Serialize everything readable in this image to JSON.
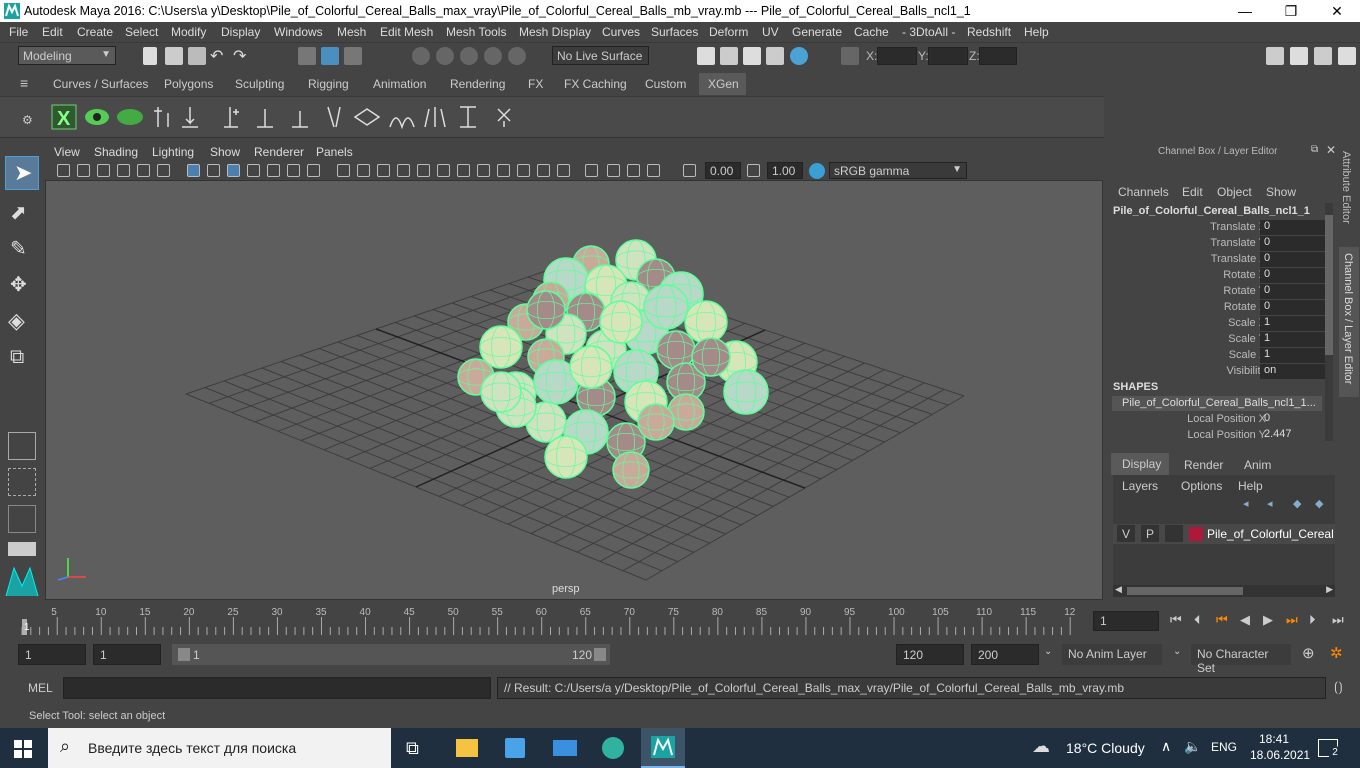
{
  "window": {
    "title": "Autodesk Maya 2016: C:\\Users\\a y\\Desktop\\Pile_of_Colorful_Cereal_Balls_max_vray\\Pile_of_Colorful_Cereal_Balls_mb_vray.mb   ---   Pile_of_Colorful_Cereal_Balls_ncl1_1",
    "minimize": "—",
    "maximize": "❐",
    "close": "✕"
  },
  "menubar": [
    "File",
    "Edit",
    "Create",
    "Select",
    "Modify",
    "Display",
    "Windows",
    "Mesh",
    "Edit Mesh",
    "Mesh Tools",
    "Mesh Display",
    "Curves",
    "Surfaces",
    "Deform",
    "UV",
    "Generate",
    "Cache",
    "- 3DtoAll -",
    "Redshift",
    "Help"
  ],
  "statusline": {
    "mode": "Modeling",
    "live_surface": "No Live Surface",
    "x_label": "X:",
    "y_label": "Y:",
    "z_label": "Z:"
  },
  "shelf_tabs": [
    "Curves / Surfaces",
    "Polygons",
    "Sculpting",
    "Rigging",
    "Animation",
    "Rendering",
    "FX",
    "FX Caching",
    "Custom",
    "XGen"
  ],
  "active_shelf_tab": "XGen",
  "viewport": {
    "menu": [
      "View",
      "Shading",
      "Lighting",
      "Show",
      "Renderer",
      "Panels"
    ],
    "exposure": "0.00",
    "gamma": "1.00",
    "color_space": "sRGB gamma",
    "camera_label": "persp"
  },
  "channel_box": {
    "header": "Channel Box / Layer Editor",
    "menu": [
      "Channels",
      "Edit",
      "Object",
      "Show"
    ],
    "object_name": "Pile_of_Colorful_Cereal_Balls_ncl1_1",
    "attributes": [
      {
        "label": "Translate X",
        "value": "0"
      },
      {
        "label": "Translate Y",
        "value": "0"
      },
      {
        "label": "Translate Z",
        "value": "0"
      },
      {
        "label": "Rotate X",
        "value": "0"
      },
      {
        "label": "Rotate Y",
        "value": "0"
      },
      {
        "label": "Rotate Z",
        "value": "0"
      },
      {
        "label": "Scale X",
        "value": "1"
      },
      {
        "label": "Scale Y",
        "value": "1"
      },
      {
        "label": "Scale Z",
        "value": "1"
      },
      {
        "label": "Visibility",
        "value": "on"
      }
    ],
    "shapes_header": "SHAPES",
    "shape_name": "Pile_of_Colorful_Cereal_Balls_ncl1_1...",
    "shape_attributes": [
      {
        "label": "Local Position X",
        "value": "0"
      },
      {
        "label": "Local Position Y",
        "value": "2.447"
      }
    ],
    "side_tabs": [
      "Attribute Editor",
      "Channel Box / Layer Editor"
    ]
  },
  "layer_editor": {
    "tabs": [
      "Display",
      "Render",
      "Anim"
    ],
    "active_tab": "Display",
    "menu": [
      "Layers",
      "Options",
      "Help"
    ],
    "layer": {
      "v": "V",
      "p": "P",
      "name": "Pile_of_Colorful_Cereal_B",
      "color": "#b0183a"
    }
  },
  "timeline": {
    "ticks": [
      "5",
      "10",
      "15",
      "20",
      "25",
      "30",
      "35",
      "40",
      "45",
      "50",
      "55",
      "60",
      "65",
      "70",
      "75",
      "80",
      "85",
      "90",
      "95",
      "100",
      "105",
      "110",
      "115",
      "12"
    ],
    "current_frame_marker": "1",
    "current_frame": "1"
  },
  "range": {
    "start": "1",
    "playback_start": "1",
    "slider_start": "1",
    "slider_end": "120",
    "playback_end": "120",
    "end": "200",
    "anim_layer": "No Anim Layer",
    "character_set": "No Character Set"
  },
  "command_line": {
    "label": "MEL",
    "result": "// Result: C:/Users/a y/Desktop/Pile_of_Colorful_Cereal_Balls_max_vray/Pile_of_Colorful_Cereal_Balls_mb_vray.mb"
  },
  "help_line": "Select Tool: select an object",
  "taskbar": {
    "search_placeholder": "Введите здесь текст для поиска",
    "weather": "18°C  Cloudy",
    "language": "ENG",
    "time": "18:41",
    "date": "18.06.2021",
    "notifications": "2"
  },
  "colors": {
    "accent": "#4a9fd4",
    "wireframe": "#5dff9a",
    "active_tab_bg": "#5a5a5a"
  }
}
